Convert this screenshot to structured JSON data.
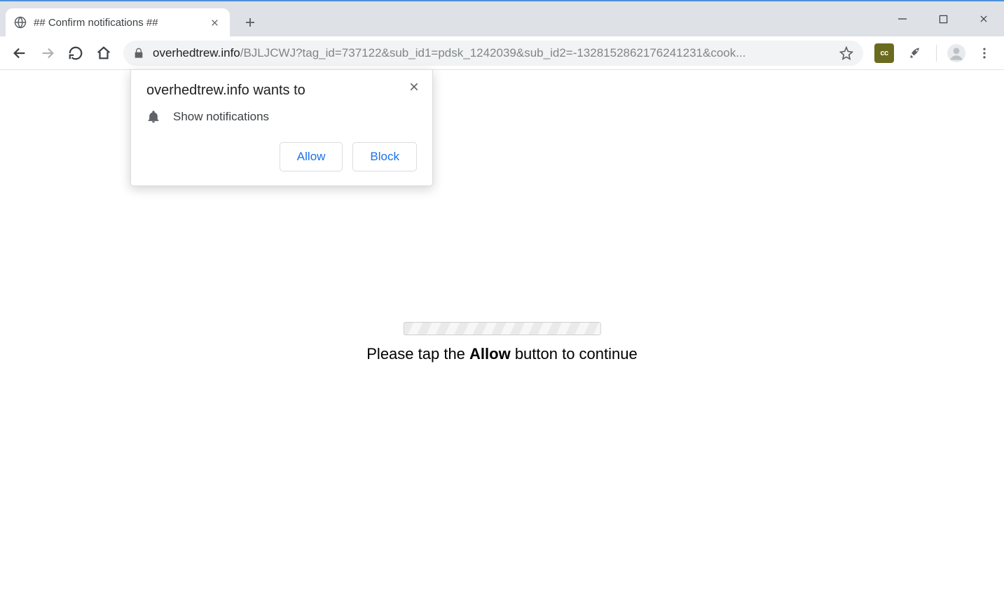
{
  "tab": {
    "title": "## Confirm notifications ##"
  },
  "url": {
    "host": "overhedtrew.info",
    "path": "/BJLJCWJ?tag_id=737122&sub_id1=pdsk_1242039&sub_id2=-1328152862176241231&cook..."
  },
  "popup": {
    "title": "overhedtrew.info wants to",
    "permission_label": "Show notifications",
    "allow_label": "Allow",
    "block_label": "Block"
  },
  "page": {
    "msg_prefix": "Please tap the ",
    "msg_bold": "Allow",
    "msg_suffix": " button to continue"
  }
}
